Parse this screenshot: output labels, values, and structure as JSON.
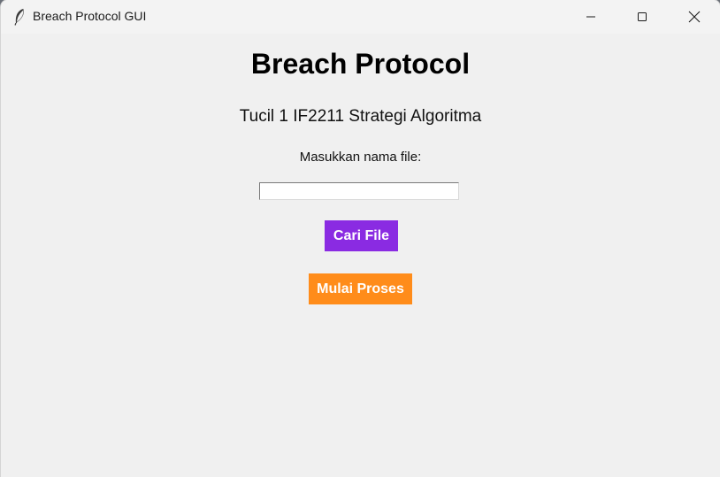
{
  "window": {
    "title": "Breach Protocol GUI",
    "icon": "feather-icon"
  },
  "titlebar_buttons": {
    "minimize_icon": "minimize-icon",
    "maximize_icon": "maximize-icon",
    "close_icon": "close-icon"
  },
  "main": {
    "heading": "Breach Protocol",
    "subtitle": "Tucil 1 IF2211 Strategi Algoritma",
    "file_label": "Masukkan nama file:",
    "file_input_value": "",
    "browse_button_label": "Cari File",
    "start_button_label": "Mulai Proses"
  },
  "colors": {
    "browse_button": "#8a2be2",
    "start_button": "#ff8c1a",
    "background": "#f0f0f0"
  }
}
